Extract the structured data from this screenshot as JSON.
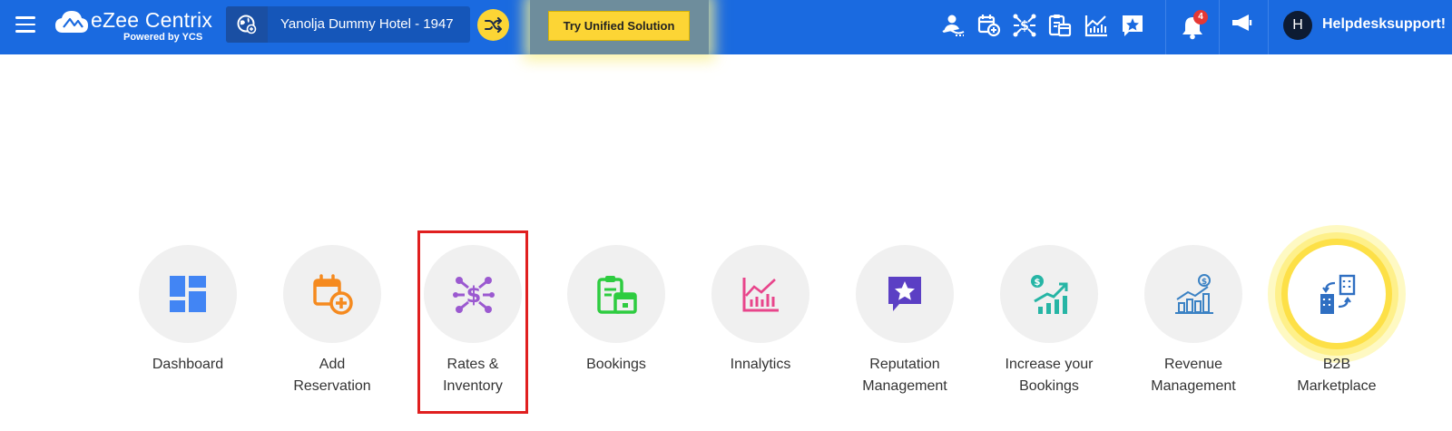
{
  "header": {
    "app_name": "eZee Centrix",
    "app_tagline": "Powered by YCS",
    "hotel_name": "Yanolja Dummy Hotel -  1947",
    "unified_button": "Try Unified Solution",
    "notification_count": "4",
    "user_initial": "H",
    "username": "Helpdesksupport!"
  },
  "modules": [
    {
      "line1": "Dashboard",
      "line2": ""
    },
    {
      "line1": "Add",
      "line2": "Reservation"
    },
    {
      "line1": "Rates &",
      "line2": "Inventory"
    },
    {
      "line1": "Bookings",
      "line2": ""
    },
    {
      "line1": "Innalytics",
      "line2": ""
    },
    {
      "line1": "Reputation",
      "line2": "Management"
    },
    {
      "line1": "Increase your",
      "line2": "Bookings"
    },
    {
      "line1": "Revenue",
      "line2": "Management"
    },
    {
      "line1": "B2B",
      "line2": "Marketplace"
    }
  ],
  "colors": {
    "topbar": "#1a6ae0",
    "accent_yellow": "#fcd535",
    "highlight_box": "#e01f1f",
    "dashboard_icon": "#4285f4",
    "add_reservation_icon": "#f58a1f",
    "rates_icon": "#9b59d0",
    "bookings_icon": "#2ecc40",
    "innalytics_icon": "#e8458b",
    "reputation_icon": "#5b3fc4",
    "increase_icon": "#26b5a5",
    "revenue_icon": "#3b82c4",
    "b2b_icon": "#2f6fc2"
  }
}
